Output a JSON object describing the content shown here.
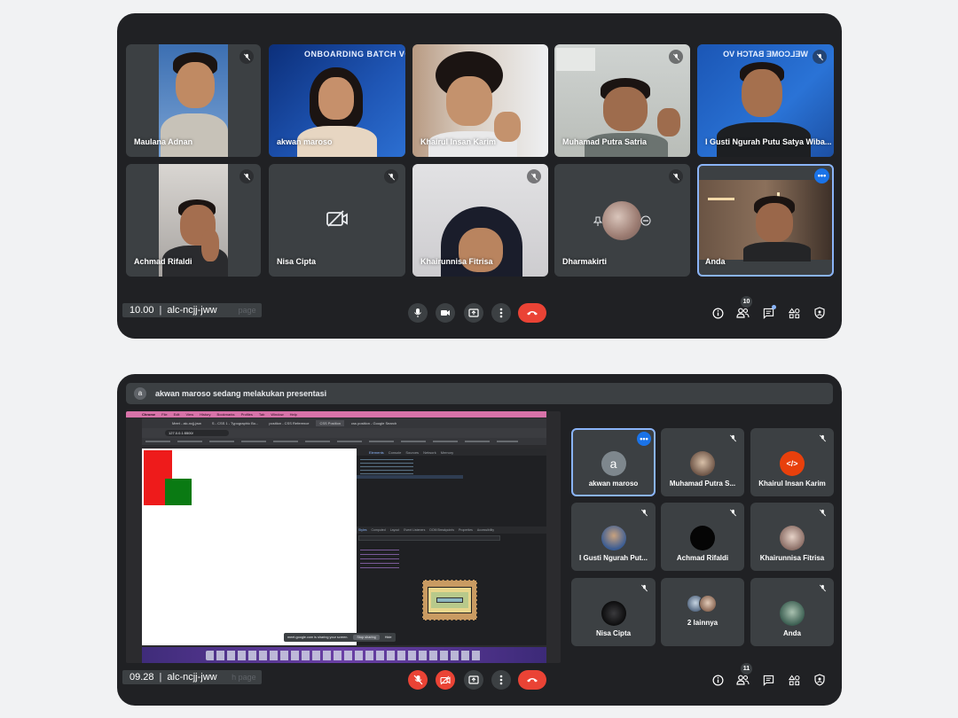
{
  "panel1": {
    "tiles": [
      {
        "name": "Maulana Adnan"
      },
      {
        "name": "akwan maroso",
        "bg_text": "ONBOARDING BATCH VO"
      },
      {
        "name": "Khairul Insan Karim"
      },
      {
        "name": "Muhamad Putra Satria"
      },
      {
        "name": "I Gusti Ngurah Putu Satya Wiba...",
        "bg_text": "WELCOME BATCH VO"
      },
      {
        "name": "Achmad Rifaldi"
      },
      {
        "name": "Nisa Cipta"
      },
      {
        "name": "Khairunnisa Fitrisa"
      },
      {
        "name": "Dharmakirti"
      },
      {
        "name": "Anda"
      }
    ],
    "time": "10.00",
    "meeting_code": "alc-ncjj-jww",
    "ghost_text": "page",
    "participant_count": "10"
  },
  "panel2": {
    "presenter_initial": "a",
    "presenter_text": "akwan maroso sedang melakukan presentasi",
    "tiles": [
      {
        "name": "akwan maroso",
        "initial": "a"
      },
      {
        "name": "Muhamad Putra S..."
      },
      {
        "name": "Khairul Insan Karim"
      },
      {
        "name": "I Gusti Ngurah Put..."
      },
      {
        "name": "Achmad Rifaldi"
      },
      {
        "name": "Khairunnisa Fitrisa"
      },
      {
        "name": "Nisa Cipta"
      },
      {
        "name": "2 lainnya"
      },
      {
        "name": "Anda"
      }
    ],
    "time": "09.28",
    "meeting_code": "alc-ncjj-jww",
    "ghost_text": "h page",
    "participant_count": "11"
  },
  "screen_share": {
    "mac_menu": [
      "Chrome",
      "File",
      "Edit",
      "View",
      "History",
      "Bookmarks",
      "Profiles",
      "Tab",
      "Window",
      "Help"
    ],
    "tabs": [
      "Meet - alc-ncjj-jww",
      "S - CSS 1 - Typographic Bo...",
      "position - CSS Reference",
      "CSS Position",
      "css position - Google Search"
    ],
    "url": "127.0.0.1:5500/",
    "devtools_tabs": [
      "Elements",
      "Console",
      "Sources",
      "Network",
      "Memory"
    ],
    "style_tabs": [
      "Styles",
      "Computed",
      "Layout",
      "Event Listeners",
      "DOM Breakpoints",
      "Properties",
      "Accessibility"
    ],
    "sharing_notice": "meet.google.com is sharing your screen.",
    "stop_sharing": "Stop sharing",
    "hide": "Hide"
  },
  "colors": {
    "panel_bg": "#202124",
    "tile_bg": "#3c4043",
    "active_outline": "#8ab4f8",
    "end_call": "#ea4335",
    "more_blue": "#1a73e8"
  }
}
